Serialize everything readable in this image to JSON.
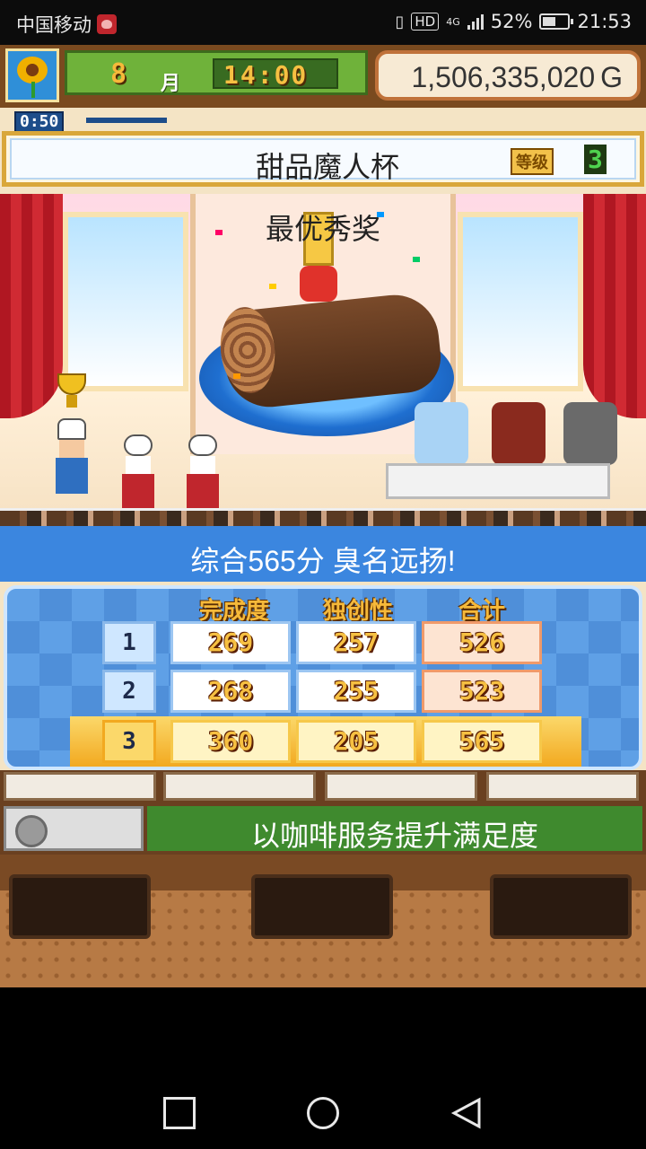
{
  "status_bar": {
    "carrier": "中国移动",
    "battery": "52%",
    "battery_level": 0.52,
    "time": "21:53",
    "network": "4G",
    "hd_label": "HD"
  },
  "hud": {
    "month": "8",
    "month_label": "月",
    "clock": "14:00",
    "money": "1,506,335,020",
    "currency": "G",
    "timer": "0:50",
    "avatar_icon": "sunflower-icon"
  },
  "contest": {
    "name": "甜品魔人杯",
    "rank_label": "等级",
    "rank_value": "3"
  },
  "stage": {
    "award": "最优秀奖"
  },
  "result": {
    "summary": "综合565分 臭名远扬!"
  },
  "score_table": {
    "headers": [
      "完成度",
      "独创性",
      "合计"
    ],
    "rows": [
      {
        "rank": "1",
        "completion": "269",
        "originality": "257",
        "total": "526"
      },
      {
        "rank": "2",
        "completion": "268",
        "originality": "255",
        "total": "523"
      },
      {
        "rank": "3",
        "completion": "360",
        "originality": "205",
        "total": "565"
      }
    ]
  },
  "hint": {
    "text": "以咖啡服务提升满足度",
    "icon": "coffee-cup-icon"
  },
  "nav": {
    "recent": "recent-apps-icon",
    "home": "home-icon",
    "back": "back-icon"
  },
  "colors": {
    "banner_blue": "#3b86df",
    "hint_green": "#3f8a2e",
    "highlight_gold": "#f2a920"
  }
}
